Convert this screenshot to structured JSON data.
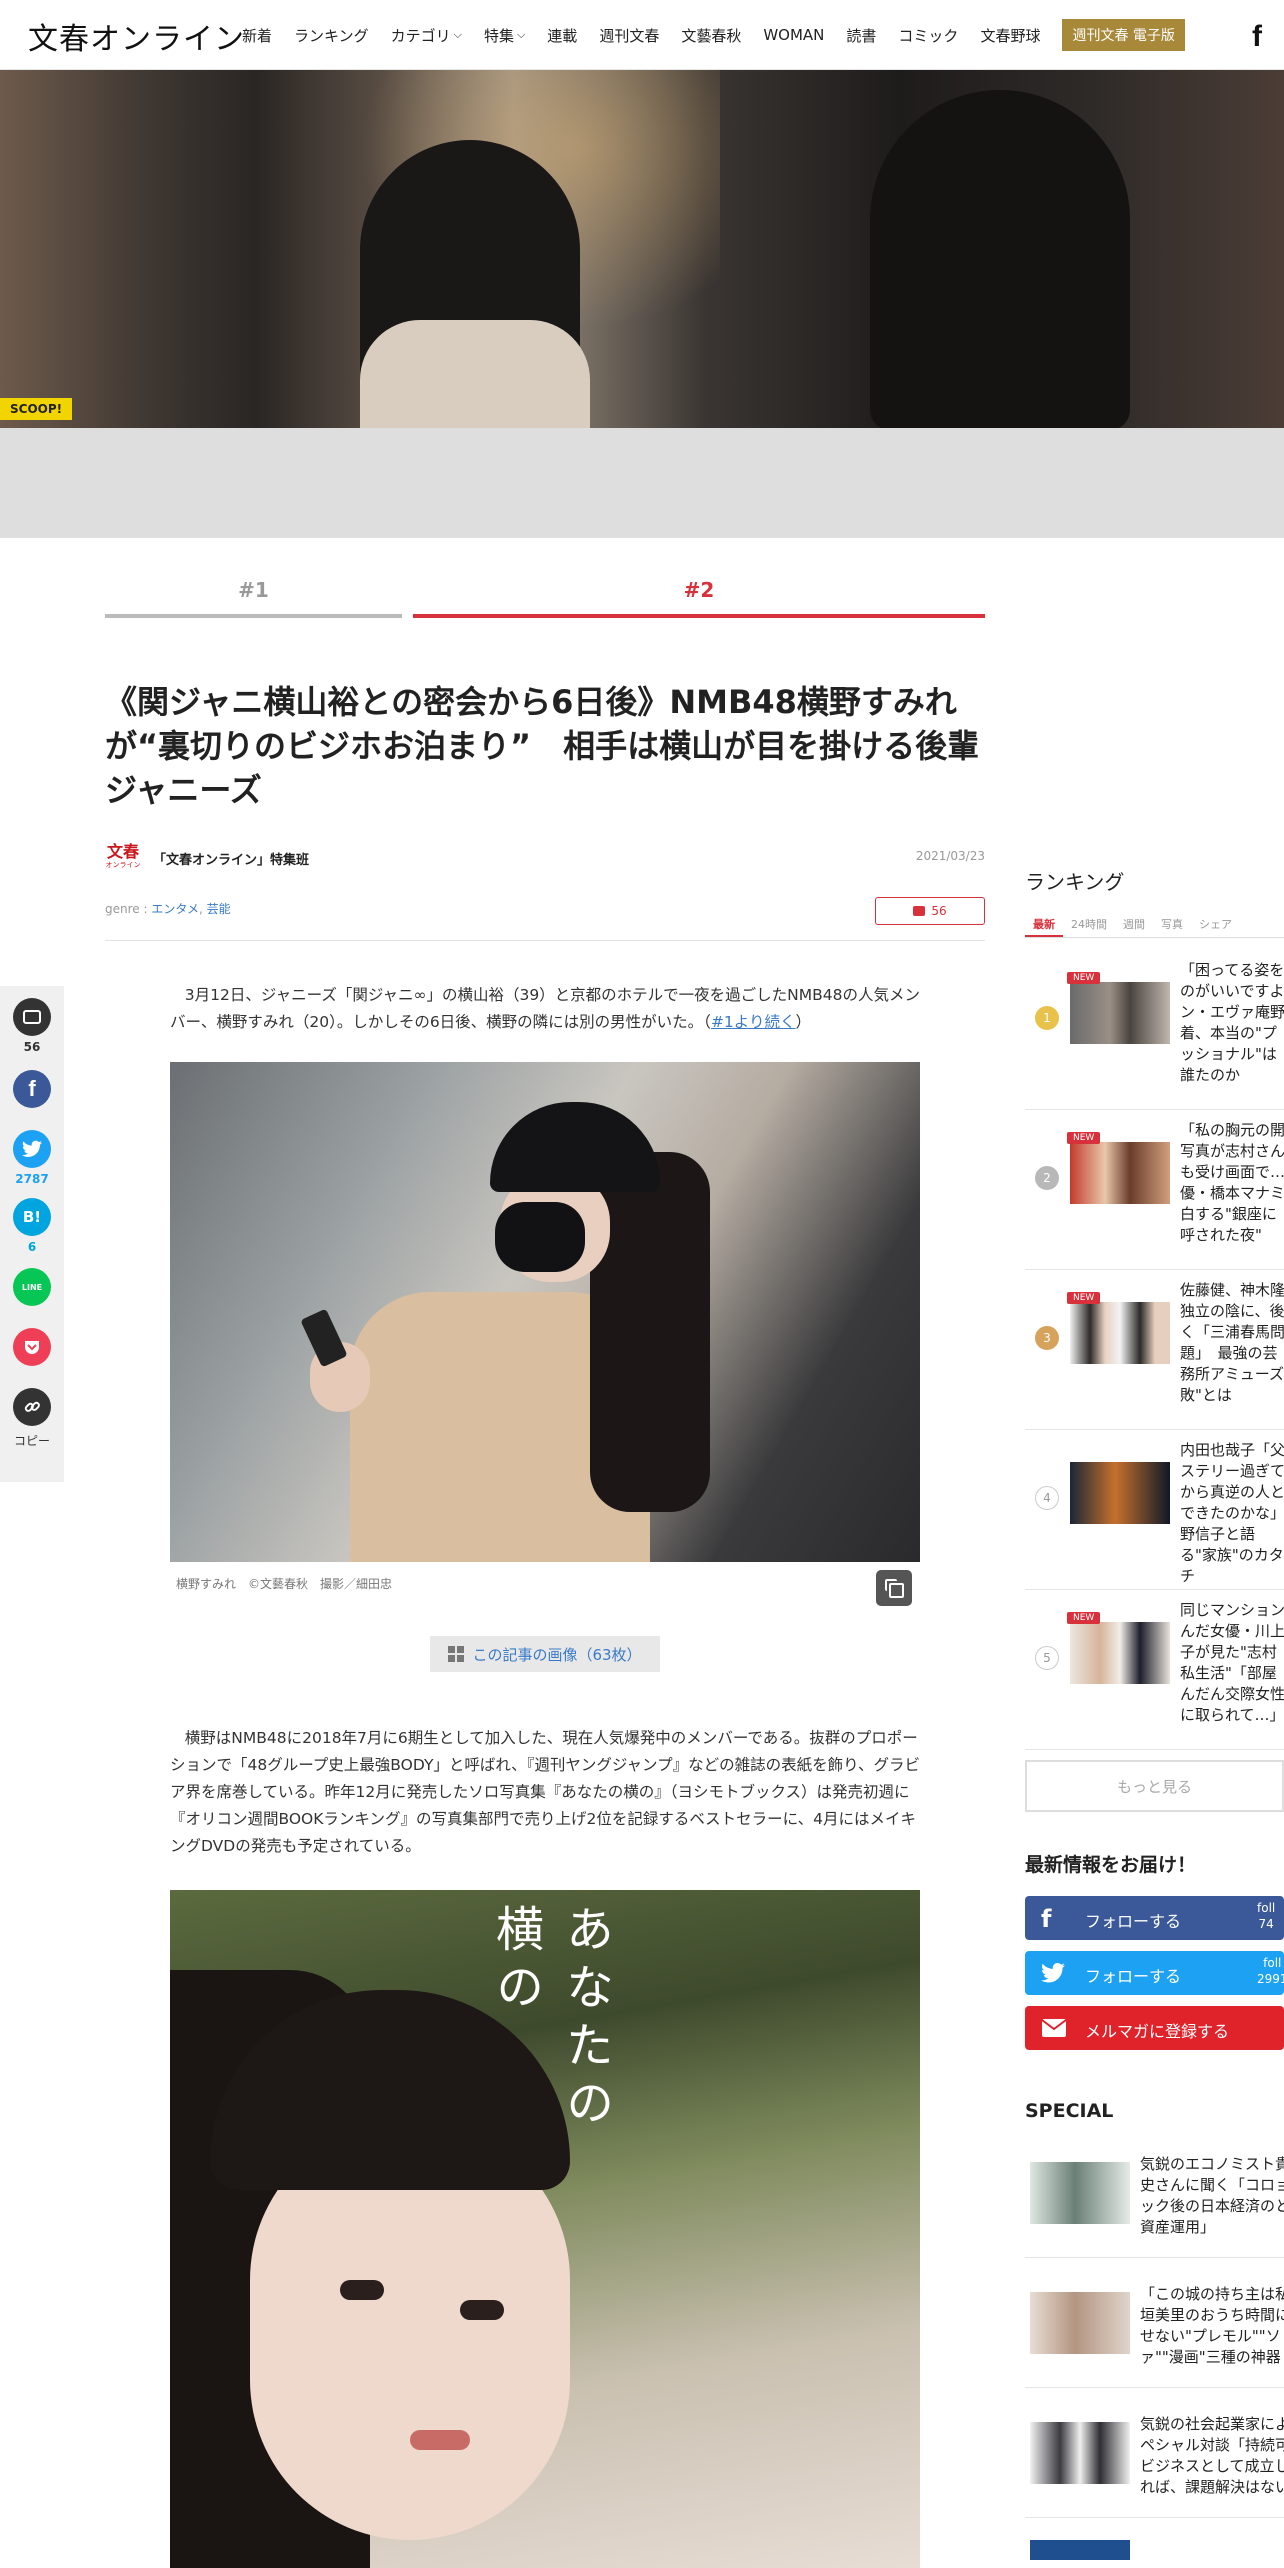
{
  "header": {
    "logo": "文春オンライン",
    "nav": [
      {
        "label": "新着",
        "chevron": false
      },
      {
        "label": "ランキング",
        "chevron": false
      },
      {
        "label": "カテゴリ",
        "chevron": true
      },
      {
        "label": "特集",
        "chevron": true
      },
      {
        "label": "連載",
        "chevron": false
      },
      {
        "label": "週刊文春",
        "chevron": false
      },
      {
        "label": "文藝春秋",
        "chevron": false
      },
      {
        "label": "WOMAN",
        "chevron": false
      },
      {
        "label": "読書",
        "chevron": false
      },
      {
        "label": "コミック",
        "chevron": false
      },
      {
        "label": "文春野球",
        "chevron": false
      }
    ],
    "ebook_label": "週刊文春 電子版",
    "facebook_glyph": "f"
  },
  "hero": {
    "badge": "SCOOP!"
  },
  "tabs": [
    {
      "label": "#1",
      "active": false
    },
    {
      "label": "#2",
      "active": true
    }
  ],
  "article": {
    "title": "《関ジャニ横山裕との密会から6日後》NMB48横野すみれが“裏切りのビジホお泊まり”　相手は横山が目を掛ける後輩ジャニーズ",
    "author_logo_main": "文春",
    "author_logo_sub": "オンライン",
    "author": "「文春オンライン」特集班",
    "date": "2021/03/23",
    "genre_prefix": "genre : ",
    "genres": [
      "エンタメ",
      "芸能"
    ],
    "genre_sep": ", ",
    "comment_count": "56",
    "para1_text": "3月12日、ジャニーズ「関ジャニ∞」の横山裕（39）と京都のホテルで一夜を過ごしたNMB48の人気メンバー、横野すみれ（20）。しかしその6日後、横野の隣には別の男性がいた。（",
    "para1_link": "#1より続く",
    "para1_end": "）",
    "photo1_caption": "横野すみれ　©文藝春秋　撮影／細田忠",
    "gallery_label": "この記事の画像（63枚）",
    "para2": "横野はNMB48に2018年7月に6期生として加入した、現在人気爆発中のメンバーである。抜群のプロポーションで「48グループ史上最強BODY」と呼ばれ、『週刊ヤングジャンプ』などの雑誌の表紙を飾り、グラビア界を席巻している。昨年12月に発売したソロ写真集『あなたの横の』（ヨシモトブックス）は発売初週に『オリコン週間BOOKランキング』の写真集部門で売り上げ2位を記録するベストセラーに、4月にはメイキングDVDの発売も予定されている。",
    "photo2_title_a": "あなたの",
    "photo2_title_b": "横の"
  },
  "share": {
    "comment_count": "56",
    "twitter_count": "2787",
    "hatena_count": "6",
    "hatena_glyph": "B!",
    "line_glyph": "LINE",
    "copy_label": "コピー"
  },
  "sidebar": {
    "ranking_title": "ランキング",
    "ranking_tabs": [
      "最新",
      "24時間",
      "週間",
      "写真",
      "シェア"
    ],
    "ranking": [
      {
        "rank": "1",
        "new": true,
        "text": "「困ってる姿をのがいいですよン・エヴァ庵野着、本当の\"プッショナル\"は誰たのか"
      },
      {
        "rank": "2",
        "new": true,
        "text": "「私の胸元の開写真が志村さんも受け画面で…優・橋本マナミ白する\"銀座に呼された夜\""
      },
      {
        "rank": "3",
        "new": true,
        "text": "佐藤健、神木隆独立の陰に、後く「三浦春馬問題」　最強の芸務所アミューズ敗\"とは"
      },
      {
        "rank": "4",
        "new": false,
        "text": "内田也哉子「父ステリー過ぎてから真逆の人とできたのかな」野信子と語る\"家族\"のカタチ"
      },
      {
        "rank": "5",
        "new": true,
        "text": "同じマンションんだ女優・川上子が見た\"志村私生活\"「部屋んだん交際女性に取られて…」"
      }
    ],
    "new_label": "NEW",
    "more_label": "もっと見る",
    "follow_title": "最新情報をお届け！",
    "fb_follow": "フォローする",
    "fb_count_label": "foll",
    "fb_count": "74",
    "tw_follow": "フォローする",
    "tw_count_label": "foll",
    "tw_count": "2991",
    "mail_label": "メルマガに登録する",
    "special_title": "SPECIAL",
    "special": [
      {
        "text": "気鋭のエコノミスト貴史さんに聞く「コロョック後の日本経済のと資産運用」"
      },
      {
        "text": "「この城の持ち主は私垣美里のおうち時間にせない\"プレモル\"\"ソァ\"\"漫画\"三種の神器"
      },
      {
        "text": "気鋭の社会起業家によペシャル対談「持続可ビジネスとして成立しれば、課題解決はない"
      }
    ]
  },
  "colors": {
    "accent_red": "#d8313b",
    "ebook_gold": "#a8893a",
    "link_blue": "#3a7bc8",
    "facebook": "#3b5998",
    "twitter": "#1da1f2",
    "hatena": "#00a4de",
    "line": "#06c755",
    "pocket": "#ef3f56",
    "scoop_yellow": "#f2d500"
  }
}
